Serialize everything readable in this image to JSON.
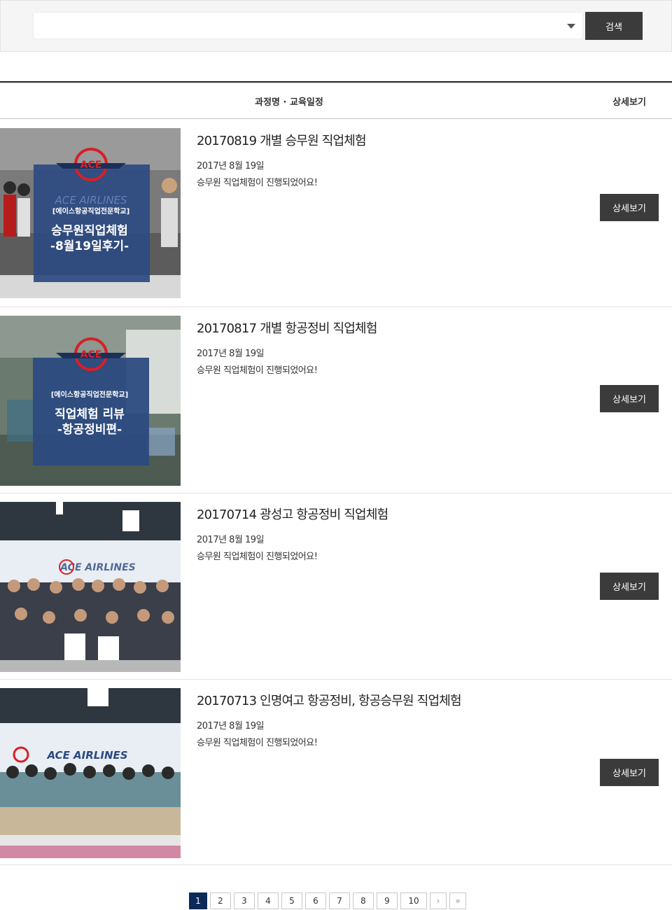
{
  "search": {
    "select_value": "",
    "button_label": "검색"
  },
  "table_header": {
    "title_col": "과정명 · 교육일정",
    "detail_col": "상세보기"
  },
  "rows": [
    {
      "title": "20170819 개별 승무원 직업체험",
      "date": "2017년 8월 19일",
      "desc": "승무원 직업체험이 진행되었어요!",
      "button": "상세보기",
      "thumb": {
        "brand": "ACE AIRLINES",
        "school": "[에이스항공직업전문학교]",
        "line1": "승무원직업체험",
        "line2": "-8월19일후기-"
      }
    },
    {
      "title": "20170817 개별 항공정비 직업체험",
      "date": "2017년 8월 19일",
      "desc": "승무원 직업체험이 진행되었어요!",
      "button": "상세보기",
      "thumb": {
        "school": "[에이스항공직업전문학교]",
        "line1": "직업체험 리뷰",
        "line2": "-항공정비편-"
      }
    },
    {
      "title": "20170714 광성고 항공정비 직업체험",
      "date": "2017년 8월 19일",
      "desc": "승무원 직업체험이 진행되었어요!",
      "button": "상세보기",
      "thumb": {
        "brand": "ACE AIRLINES"
      }
    },
    {
      "title": "20170713 인명여고 항공정비, 항공승무원 직업체험",
      "date": "2017년 8월 19일",
      "desc": "승무원 직업체험이 진행되었어요!",
      "button": "상세보기",
      "thumb": {
        "brand": "ACE AIRLINES"
      }
    }
  ],
  "pagination": {
    "pages": [
      "1",
      "2",
      "3",
      "4",
      "5",
      "6",
      "7",
      "8",
      "9",
      "10"
    ],
    "current": "1",
    "next_label": "›",
    "last_label": "»"
  },
  "colors": {
    "button_bg": "#3b3b3b",
    "pager_active": "#0b2a57",
    "thumb_panel": "#2c4a80",
    "logo_red": "#d81f26"
  },
  "icons": {
    "select_caret": "chevron-down-icon",
    "next": "chevron-right-icon",
    "last": "double-chevron-right-icon"
  }
}
